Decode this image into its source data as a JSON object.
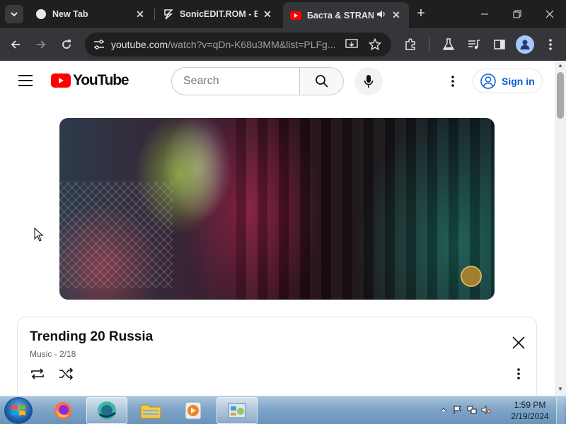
{
  "browser": {
    "tabs": [
      {
        "title": "New Tab",
        "favicon": "chrome-favicon",
        "active": false
      },
      {
        "title": "SonicEDIT.ROM - EY",
        "favicon": "sonicedit-favicon",
        "active": false
      },
      {
        "title": "Баста & STRANI",
        "favicon": "youtube-favicon",
        "active": true,
        "audio": true
      }
    ],
    "address": {
      "host": "youtube.com",
      "path": "/watch?v=qDn-K68u3MM&list=PLFg..."
    }
  },
  "youtube": {
    "logo_text": "YouTube",
    "search_placeholder": "Search",
    "signin_label": "Sign in",
    "brand_color": "#ff0000",
    "link_color": "#065fd4"
  },
  "playlist": {
    "title": "Trending 20 Russia",
    "subtitle": "Music - 2/18"
  },
  "taskbar": {
    "time": "1:59 PM",
    "date": "2/19/2024",
    "apps": [
      "firefox-icon",
      "app-icon",
      "explorer-icon",
      "media-player-icon",
      "control-panel-icon"
    ]
  }
}
